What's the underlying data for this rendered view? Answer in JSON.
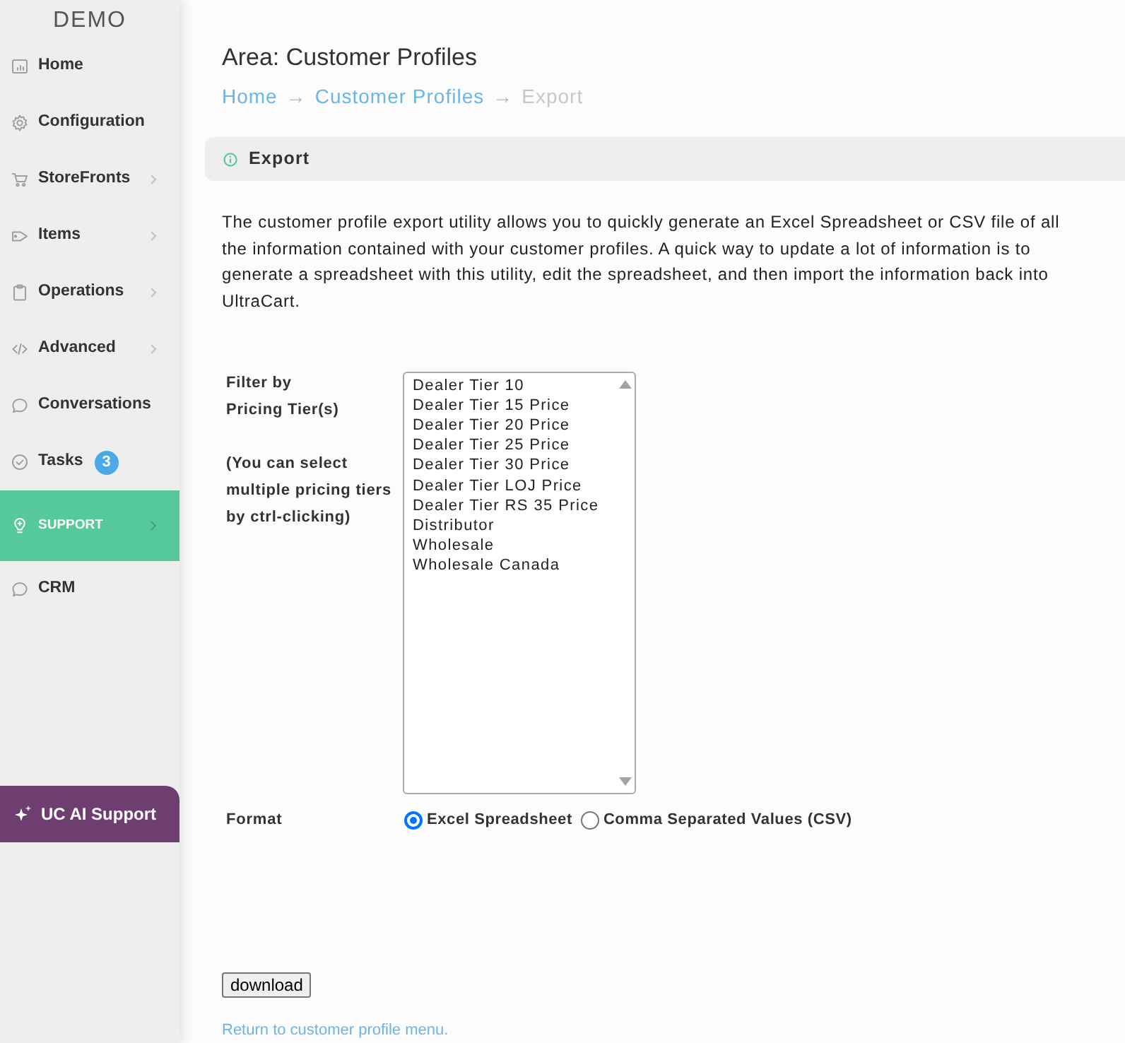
{
  "sidebar": {
    "brand": "DEMO",
    "items": [
      {
        "label": "Home",
        "has_submenu": false,
        "selected": false
      },
      {
        "label": "Configuration",
        "has_submenu": false,
        "selected": false
      },
      {
        "label": "StoreFronts",
        "has_submenu": true,
        "selected": false
      },
      {
        "label": "Items",
        "has_submenu": true,
        "selected": false
      },
      {
        "label": "Operations",
        "has_submenu": true,
        "selected": false
      },
      {
        "label": "Advanced",
        "has_submenu": true,
        "selected": false
      },
      {
        "label": "Conversations",
        "has_submenu": false,
        "selected": false
      },
      {
        "label": "Tasks",
        "has_submenu": false,
        "selected": false,
        "badge": "3"
      },
      {
        "label": "SUPPORT",
        "has_submenu": true,
        "selected": true
      },
      {
        "label": "CRM",
        "has_submenu": false,
        "selected": false
      }
    ],
    "ai_button": {
      "label": "UC AI Support"
    }
  },
  "header": {
    "title": "Area: Customer Profiles",
    "breadcrumb": [
      {
        "kind": "link",
        "label": "Home"
      },
      {
        "kind": "separator",
        "label": "→"
      },
      {
        "kind": "link",
        "label": "Customer Profiles"
      },
      {
        "kind": "separator",
        "label": "→"
      },
      {
        "kind": "current",
        "label": "Export"
      }
    ]
  },
  "panel": {
    "title": "Export",
    "description": "The customer profile export utility allows you to quickly generate an Excel Spreadsheet or CSV file of all the information contained with your customer profiles. A quick way to update a lot of information is to generate a spreadsheet with this utility, edit the spreadsheet, and then import the information back into UltraCart.",
    "filter": {
      "label": "Filter by Pricing Tier(s)",
      "hint": "(You can select multiple pricing tiers by ctrl-clicking)",
      "options": [
        {
          "label": "Dealer Tier 10",
          "selected": false
        },
        {
          "label": "Dealer Tier 15 Price",
          "selected": false
        },
        {
          "label": "Dealer Tier 20 Price",
          "selected": false
        },
        {
          "label": "Dealer Tier 25 Price",
          "selected": false
        },
        {
          "label": "Dealer Tier 30 Price",
          "selected": false
        },
        {
          "label": "Dealer Tier LOJ Price",
          "selected": false
        },
        {
          "label": "Dealer Tier RS 35 Price",
          "selected": false
        },
        {
          "label": "Distributor",
          "selected": false
        },
        {
          "label": "Wholesale",
          "selected": false
        },
        {
          "label": "Wholesale Canada",
          "selected": false
        }
      ]
    },
    "format": {
      "label": "Format",
      "options": [
        {
          "label": "Excel Spreadsheet",
          "selected": true
        },
        {
          "label": "Comma Separated Values (CSV)",
          "selected": false
        }
      ]
    },
    "download_button": "download",
    "return_link": "Return to customer profile menu."
  }
}
